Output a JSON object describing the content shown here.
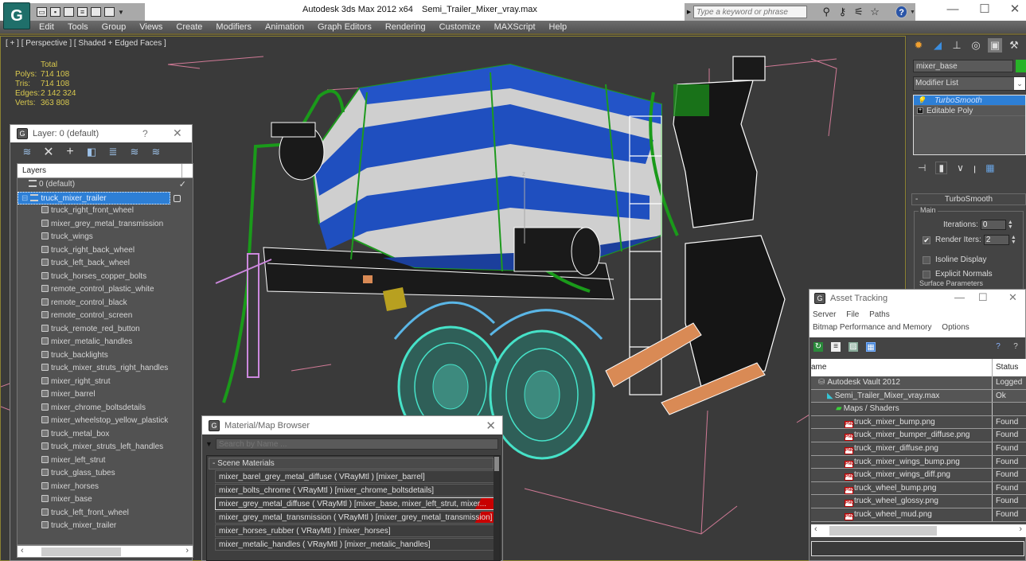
{
  "window": {
    "app_title": "Autodesk 3ds Max  2012 x64",
    "file_name": "Semi_Trailer_Mixer_vray.max",
    "search_placeholder": "Type a keyword or phrase",
    "minimize": "—",
    "maximize": "☐",
    "close": "✕"
  },
  "menu": [
    "Edit",
    "Tools",
    "Group",
    "Views",
    "Create",
    "Modifiers",
    "Animation",
    "Graph Editors",
    "Rendering",
    "Customize",
    "MAXScript",
    "Help"
  ],
  "viewport": {
    "label": "[ + ] [ Perspective ] [ Shaded + Edged Faces ]",
    "stats_header": "Total",
    "stats": [
      {
        "label": "Polys:",
        "value": "714 108"
      },
      {
        "label": "Tris:",
        "value": "714 108"
      },
      {
        "label": "Edges:",
        "value": "2 142 324"
      },
      {
        "label": "Verts:",
        "value": "363 808"
      }
    ],
    "axis_label": "z"
  },
  "layer_window": {
    "title": "Layer: 0 (default)",
    "help": "?",
    "close": "✕",
    "header": "Layers",
    "layers": [
      {
        "name": "0 (default)",
        "type": "layer",
        "checked": true
      },
      {
        "name": "truck_mixer_trailer",
        "type": "layer",
        "selected": true
      }
    ],
    "objects": [
      "truck_right_front_wheel",
      "mixer_grey_metal_transmission",
      "truck_wings",
      "truck_right_back_wheel",
      "truck_left_back_wheel",
      "truck_horses_copper_bolts",
      "remote_control_plastic_white",
      "remote_control_black",
      "remote_control_screen",
      "truck_remote_red_button",
      "mixer_metalic_handles",
      "truck_backlights",
      "truck_mixer_struts_right_handles",
      "mixer_right_strut",
      "mixer_barrel",
      "mixer_chrome_boltsdetails",
      "mixer_wheelstop_yellow_plastick",
      "truck_metal_box",
      "truck_mixer_struts_left_handles",
      "mixer_left_strut",
      "truck_glass_tubes",
      "mixer_horses",
      "mixer_base",
      "truck_left_front_wheel",
      "truck_mixer_trailer"
    ]
  },
  "material_browser": {
    "title": "Material/Map Browser",
    "search_placeholder": "Search by Name ...",
    "group": "- Scene Materials",
    "materials": [
      {
        "text": "mixer_barel_grey_metal_diffuse  ( VRayMtl ) [mixer_barrel]",
        "warn": false,
        "highlight": false
      },
      {
        "text": "mixer_bolts_chrome  ( VRayMtl ) [mixer_chrome_boltsdetails]",
        "warn": false,
        "highlight": false
      },
      {
        "text": "mixer_grey_metal_diffuse  ( VRayMtl ) [mixer_base, mixer_left_strut, mixer...",
        "warn": true,
        "highlight": true
      },
      {
        "text": "mixer_grey_metal_transmission  ( VRayMtl ) [mixer_grey_metal_transmission]",
        "warn": true,
        "highlight": false
      },
      {
        "text": "mixer_horses_rubber  ( VRayMtl ) [mixer_horses]",
        "warn": false,
        "highlight": false
      },
      {
        "text": "mixer_metalic_handles  ( VRayMtl ) [mixer_metalic_handles]",
        "warn": false,
        "highlight": false
      }
    ]
  },
  "command_panel": {
    "object_name": "mixer_base",
    "object_color": "#28b328",
    "modifier_list": "Modifier List",
    "stack": [
      {
        "name": "TurboSmooth",
        "selected": true
      },
      {
        "name": "Editable Poly",
        "selected": false
      }
    ],
    "rollout_title": "TurboSmooth",
    "group_main": "Main",
    "iterations_label": "Iterations:",
    "iterations_value": "0",
    "render_iters_label": "Render Iters:",
    "render_iters_value": "2",
    "render_iters_checked": true,
    "isoline_label": "Isoline Display",
    "explicit_normals_label": "Explicit Normals",
    "surface_params_label": "Surface Parameters"
  },
  "asset_tracking": {
    "title": "Asset Tracking",
    "menu_row1": [
      "Server",
      "File",
      "Paths"
    ],
    "menu_row2": [
      "Bitmap Performance and Memory",
      "Options"
    ],
    "col_name": "ame",
    "col_status": "Status",
    "rows": [
      {
        "name": "Autodesk Vault 2012",
        "status": "Logged",
        "indent": 1,
        "icon": "vault"
      },
      {
        "name": "Semi_Trailer_Mixer_vray.max",
        "status": "Ok",
        "indent": 2,
        "icon": "max"
      },
      {
        "name": "Maps / Shaders",
        "status": "",
        "indent": 3,
        "icon": "maps"
      },
      {
        "name": "truck_mixer_bump.png",
        "status": "Found",
        "indent": 4,
        "icon": "png"
      },
      {
        "name": "truck_mixer_bumper_diffuse.png",
        "status": "Found",
        "indent": 4,
        "icon": "png"
      },
      {
        "name": "truck_mixer_diffuse.png",
        "status": "Found",
        "indent": 4,
        "icon": "png"
      },
      {
        "name": "truck_mixer_wings_bump.png",
        "status": "Found",
        "indent": 4,
        "icon": "png"
      },
      {
        "name": "truck_mixer_wings_diff.png",
        "status": "Found",
        "indent": 4,
        "icon": "png"
      },
      {
        "name": "truck_wheel_bump.png",
        "status": "Found",
        "indent": 4,
        "icon": "png"
      },
      {
        "name": "truck_wheel_glossy.png",
        "status": "Found",
        "indent": 4,
        "icon": "png"
      },
      {
        "name": "truck_wheel_mud.png",
        "status": "Found",
        "indent": 4,
        "icon": "png"
      }
    ]
  }
}
